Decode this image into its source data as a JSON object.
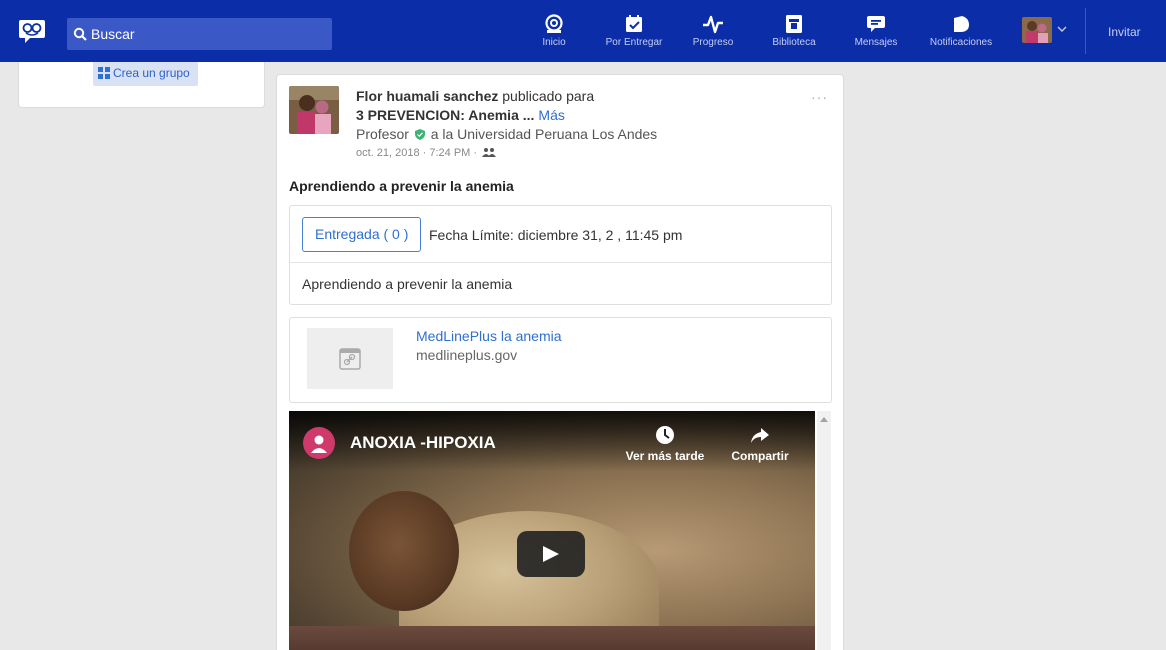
{
  "search": {
    "placeholder": "Buscar"
  },
  "nav": [
    {
      "label": "Inicio",
      "icon": "home-icon"
    },
    {
      "label": "Por Entregar",
      "icon": "assignments-icon"
    },
    {
      "label": "Progreso",
      "icon": "progress-icon"
    },
    {
      "label": "Biblioteca",
      "icon": "library-icon"
    },
    {
      "label": "Mensajes",
      "icon": "messages-icon"
    },
    {
      "label": "Notificaciones",
      "icon": "notifications-icon"
    }
  ],
  "invite_label": "Invitar",
  "sidebar": {
    "create_group_label": "Crea un grupo"
  },
  "post": {
    "author": "Flor huamali sanchez",
    "posted_for": "publicado para",
    "group": "3 PREVENCION: Anemia ...",
    "more_label": "Más",
    "role": "Profesor",
    "institution": "a la Universidad Peruana Los Andes",
    "timestamp": "oct. 21, 2018 · 7:24 PM ·",
    "menu": "···",
    "title": "Aprendiendo a prevenir la anemia",
    "assignment": {
      "submitted_label": "Entregada",
      "submitted_count": "( 0 )",
      "due": "Fecha Límite: diciembre 31, 2     , 11:45 pm",
      "description": "Aprendiendo a prevenir la anemia"
    },
    "link": {
      "title": "MedLinePlus la anemia",
      "domain": "medlineplus.gov"
    },
    "video": {
      "title": "ANOXIA -HIPOXIA",
      "watch_later": "Ver más tarde",
      "share": "Compartir"
    }
  },
  "colors": {
    "topbar": "#0b2ea8",
    "accent": "#2f6fd0",
    "verified": "#3cb371"
  }
}
